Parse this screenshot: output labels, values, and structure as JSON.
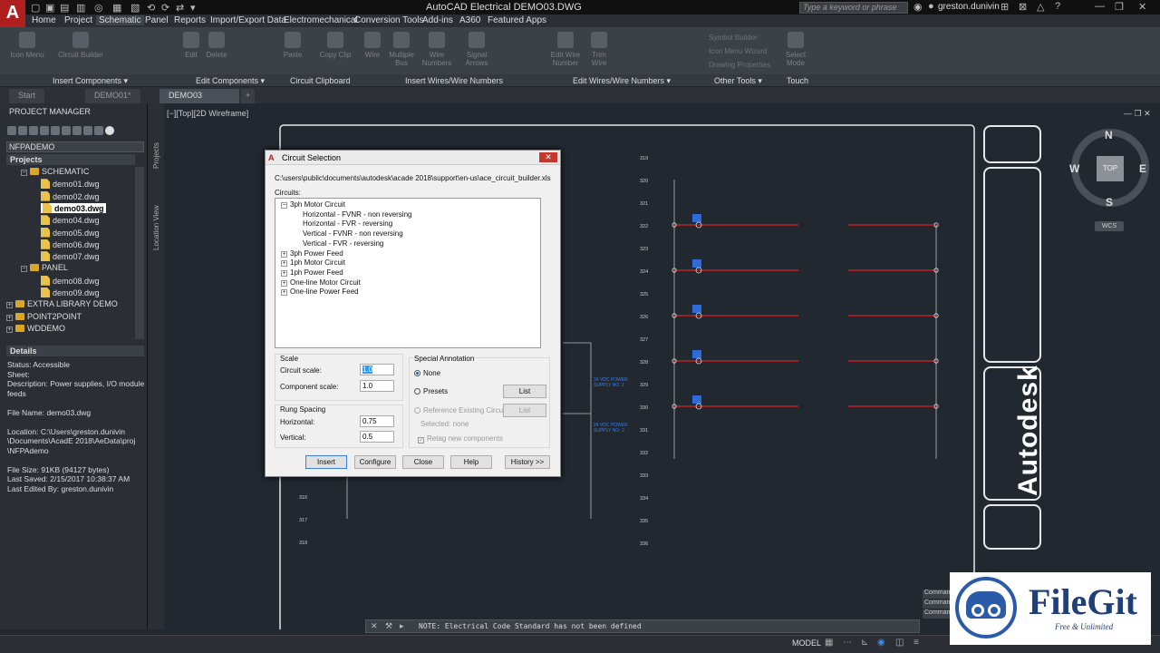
{
  "app": {
    "title": "AutoCAD Electrical    DEMO03.DWG",
    "logo_letter": "A",
    "search_placeholder": "Type a keyword or phrase",
    "user": "greston.dunivin"
  },
  "menu": {
    "items": [
      "Home",
      "Project",
      "Schematic",
      "Panel",
      "Reports",
      "Import/Export Data",
      "Electromechanical",
      "Conversion Tools",
      "Add-ins",
      "A360",
      "Featured Apps"
    ],
    "active": "Schematic"
  },
  "ribbon": {
    "buttons": [
      "Icon Menu",
      "Circuit Builder",
      "Edit",
      "Delete",
      "Paste",
      "Copy Clip",
      "Wire",
      "Multiple Bus",
      "Wire Numbers",
      "Signal Arrows",
      "Edit Wire Number",
      "Trim Wire",
      "Select Mode"
    ],
    "small_items": [
      "Symbol Builder",
      "Icon Menu Wizard",
      "Drawing Properties"
    ],
    "panels": [
      "Insert Components ▾",
      "Edit Components ▾",
      "Circuit Clipboard",
      "Insert Wires/Wire Numbers",
      "Edit Wires/Wire Numbers ▾",
      "Other Tools ▾",
      "Touch"
    ]
  },
  "file_tabs": [
    "Start",
    "DEMO01*",
    "DEMO03",
    "+"
  ],
  "project_manager": {
    "title": "PROJECT MANAGER",
    "combo": "NFPADEMO",
    "projects_header": "Projects",
    "tree": [
      {
        "label": "SCHEMATIC",
        "type": "folder",
        "indent": 1,
        "bold": true
      },
      {
        "label": "demo01.dwg",
        "type": "file",
        "indent": 2
      },
      {
        "label": "demo02.dwg",
        "type": "file",
        "indent": 2
      },
      {
        "label": "demo03.dwg",
        "type": "file",
        "indent": 2,
        "selected": true
      },
      {
        "label": "demo04.dwg",
        "type": "file",
        "indent": 2
      },
      {
        "label": "demo05.dwg",
        "type": "file",
        "indent": 2
      },
      {
        "label": "demo06.dwg",
        "type": "file",
        "indent": 2
      },
      {
        "label": "demo07.dwg",
        "type": "file",
        "indent": 2
      },
      {
        "label": "PANEL",
        "type": "folder",
        "indent": 1
      },
      {
        "label": "demo08.dwg",
        "type": "file",
        "indent": 2
      },
      {
        "label": "demo09.dwg",
        "type": "file",
        "indent": 2
      },
      {
        "label": "EXTRA LIBRARY DEMO",
        "type": "project",
        "indent": 0
      },
      {
        "label": "POINT2POINT",
        "type": "project",
        "indent": 0
      },
      {
        "label": "WDDEMO",
        "type": "project",
        "indent": 0
      }
    ],
    "details_header": "Details",
    "details": [
      "Status: Accessible",
      "Sheet:",
      "Description: Power supplies, I/O module feeds",
      "",
      "File Name: demo03.dwg",
      "",
      "Location: C:\\Users\\greston.dunivin \\Documents\\AcadE 2018\\AeData\\proj \\NFPAdemo",
      "",
      "File Size: 91KB (94127 bytes)",
      "Last Saved: 2/15/2017 10:38:37 AM",
      "Last Edited By: greston.dunivin"
    ],
    "side_tabs": [
      "Projects",
      "Location View"
    ]
  },
  "viewport": {
    "label": "[−][Top][2D Wireframe]",
    "cube_top": "TOP",
    "north": "N",
    "south": "S",
    "east": "E",
    "west": "W",
    "wcs": "WCS"
  },
  "dialog": {
    "title": "Circuit Selection",
    "path": "C:\\users\\public\\documents\\autodesk\\acade 2018\\support\\en-us\\ace_circuit_builder.xls",
    "circuits_label": "Circuits:",
    "tree": [
      {
        "label": "3ph Motor Circuit",
        "expanded": true
      },
      {
        "label": "Horizontal - FVNR - non reversing",
        "child": true
      },
      {
        "label": "Horizontal - FVR - reversing",
        "child": true
      },
      {
        "label": "Vertical - FVNR - non reversing",
        "child": true
      },
      {
        "label": "Vertical - FVR - reversing",
        "child": true
      },
      {
        "label": "3ph Power Feed"
      },
      {
        "label": "1ph Motor Circuit"
      },
      {
        "label": "1ph Power Feed"
      },
      {
        "label": "One-line Motor Circuit"
      },
      {
        "label": "One-line Power Feed"
      }
    ],
    "scale_label": "Scale",
    "circuit_scale_label": "Circuit scale:",
    "circuit_scale": "1.0",
    "component_scale_label": "Component scale:",
    "component_scale": "1.0",
    "rung_label": "Rung Spacing",
    "horizontal_label": "Horizontal:",
    "horizontal": "0.75",
    "vertical_label": "Vertical:",
    "vertical": "0.5",
    "special_label": "Special Annotation",
    "none_label": "None",
    "presets_label": "Presets",
    "reference_label": "Reference Existing Circuit",
    "selected_label": "Selected: none",
    "retag_label": "Retag new components",
    "list_label": "List",
    "buttons": [
      "Insert",
      "Configure",
      "Close",
      "Help",
      "History >>"
    ]
  },
  "drawing": {
    "rungs_right": [
      "319",
      "320",
      "321",
      "322",
      "323",
      "324",
      "325",
      "326",
      "327",
      "328",
      "329",
      "330",
      "331",
      "332",
      "333",
      "334",
      "335",
      "336"
    ],
    "rungs_left": [
      "316",
      "317",
      "318"
    ],
    "supply_labels": [
      "24 VDC POWER SUPPLY NO. 1",
      "24 VDC POWER SUPPLY NO. 2"
    ],
    "title_block_text": "Autodesk"
  },
  "command": {
    "text": "NOTE: Electrical Code Standard has not been defined",
    "history": [
      "Comman",
      "Comman",
      "Comman"
    ]
  },
  "status": {
    "model": "MODEL"
  },
  "watermark": {
    "name": "FileGit",
    "tagline": "Free & Unlimited"
  },
  "colors": {
    "accent_red": "#b01e1e",
    "wire_red": "#e02020",
    "component_blue": "#2f6bd8",
    "dialog_bg": "#f0f0f0"
  }
}
